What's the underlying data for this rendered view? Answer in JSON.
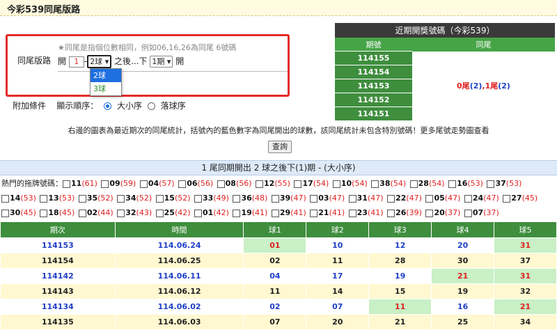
{
  "page_title": "今彩539同尾版路",
  "setup": {
    "label": "同尾版路",
    "hint": "★同尾是指個位數相同，例如06,16,26為同尾 6號碼",
    "open_label": "開",
    "open_value": "1",
    "dash": "-",
    "ball_select": "2球",
    "after_text": "之後...下",
    "period_select": "1期",
    "open_label2": "開",
    "ball_options": [
      "2球",
      "3球"
    ]
  },
  "conditions": {
    "label": "附加條件",
    "order_label": "顯示順序：",
    "option_big_small": "大小序",
    "option_draw": "落球序"
  },
  "recent": {
    "title": "近期開獎號碼（今彩539）",
    "col_period": "期號",
    "col_tail": "同尾",
    "periods": [
      "114155",
      "114154",
      "114153",
      "114152",
      "114151"
    ],
    "tail_a": "0尾",
    "tail_a_count": "(2)",
    "tail_sep": ",",
    "tail_b": "1尾",
    "tail_b_count": "(2)"
  },
  "note": "右邊的圖表為最近期次的同尾統計，括號內的藍色數字為同尾開出的球數，該同尾統計未包含特別號碼！更多尾號走勢圖查看",
  "query_button": "查詢",
  "section_title": "1 尾同期開出 2 球之後下(1)期 - (大小序)",
  "hot": {
    "label": "熱門的拖牌號碼：",
    "items": [
      [
        "11",
        "(61)"
      ],
      [
        "09",
        "(59)"
      ],
      [
        "04",
        "(57)"
      ],
      [
        "06",
        "(56)"
      ],
      [
        "08",
        "(56)"
      ],
      [
        "12",
        "(55)"
      ],
      [
        "17",
        "(54)"
      ],
      [
        "10",
        "(54)"
      ],
      [
        "38",
        "(54)"
      ],
      [
        "28",
        "(54)"
      ],
      [
        "16",
        "(53)"
      ],
      [
        "37",
        "(53)"
      ],
      [
        "14",
        "(53)"
      ],
      [
        "13",
        "(53)"
      ],
      [
        "35",
        "(52)"
      ],
      [
        "34",
        "(52)"
      ],
      [
        "15",
        "(52)"
      ],
      [
        "33",
        "(49)"
      ],
      [
        "36",
        "(48)"
      ],
      [
        "39",
        "(47)"
      ],
      [
        "03",
        "(47)"
      ],
      [
        "31",
        "(47)"
      ],
      [
        "22",
        "(47)"
      ],
      [
        "05",
        "(47)"
      ],
      [
        "24",
        "(47)"
      ],
      [
        "27",
        "(45)"
      ],
      [
        "30",
        "(45)"
      ],
      [
        "18",
        "(45)"
      ],
      [
        "02",
        "(44)"
      ],
      [
        "32",
        "(43)"
      ],
      [
        "25",
        "(42)"
      ],
      [
        "01",
        "(42)"
      ],
      [
        "19",
        "(41)"
      ],
      [
        "29",
        "(41)"
      ],
      [
        "21",
        "(41)"
      ],
      [
        "23",
        "(41)"
      ],
      [
        "26",
        "(39)"
      ],
      [
        "20",
        "(37)"
      ],
      [
        "07",
        "(37)"
      ]
    ]
  },
  "table": {
    "headers": [
      "期次",
      "時間",
      "球1",
      "球2",
      "球3",
      "球4",
      "球5"
    ],
    "rows": [
      {
        "period": "114153",
        "date": "114.06.24",
        "balls": [
          "01",
          "10",
          "12",
          "20",
          "31"
        ],
        "blue": true,
        "hl": [
          0,
          4
        ]
      },
      {
        "period": "114154",
        "date": "114.06.25",
        "balls": [
          "02",
          "11",
          "28",
          "30",
          "37"
        ],
        "blue": false,
        "hl": []
      },
      {
        "period": "114142",
        "date": "114.06.11",
        "balls": [
          "04",
          "17",
          "19",
          "21",
          "31"
        ],
        "blue": true,
        "hl": [
          3,
          4
        ]
      },
      {
        "period": "114143",
        "date": "114.06.12",
        "balls": [
          "11",
          "14",
          "15",
          "19",
          "32"
        ],
        "blue": false,
        "hl": []
      },
      {
        "period": "114134",
        "date": "114.06.02",
        "balls": [
          "02",
          "07",
          "11",
          "16",
          "21"
        ],
        "blue": true,
        "hl": [
          2,
          4
        ]
      },
      {
        "period": "114135",
        "date": "114.06.03",
        "balls": [
          "07",
          "20",
          "21",
          "25",
          "34"
        ],
        "blue": false,
        "hl": []
      }
    ]
  },
  "colors": {
    "accent_red": "#e52b2b",
    "green": "#3f8e3e",
    "blue": "#1e3fc8",
    "highlight": "#c9f0c6"
  }
}
